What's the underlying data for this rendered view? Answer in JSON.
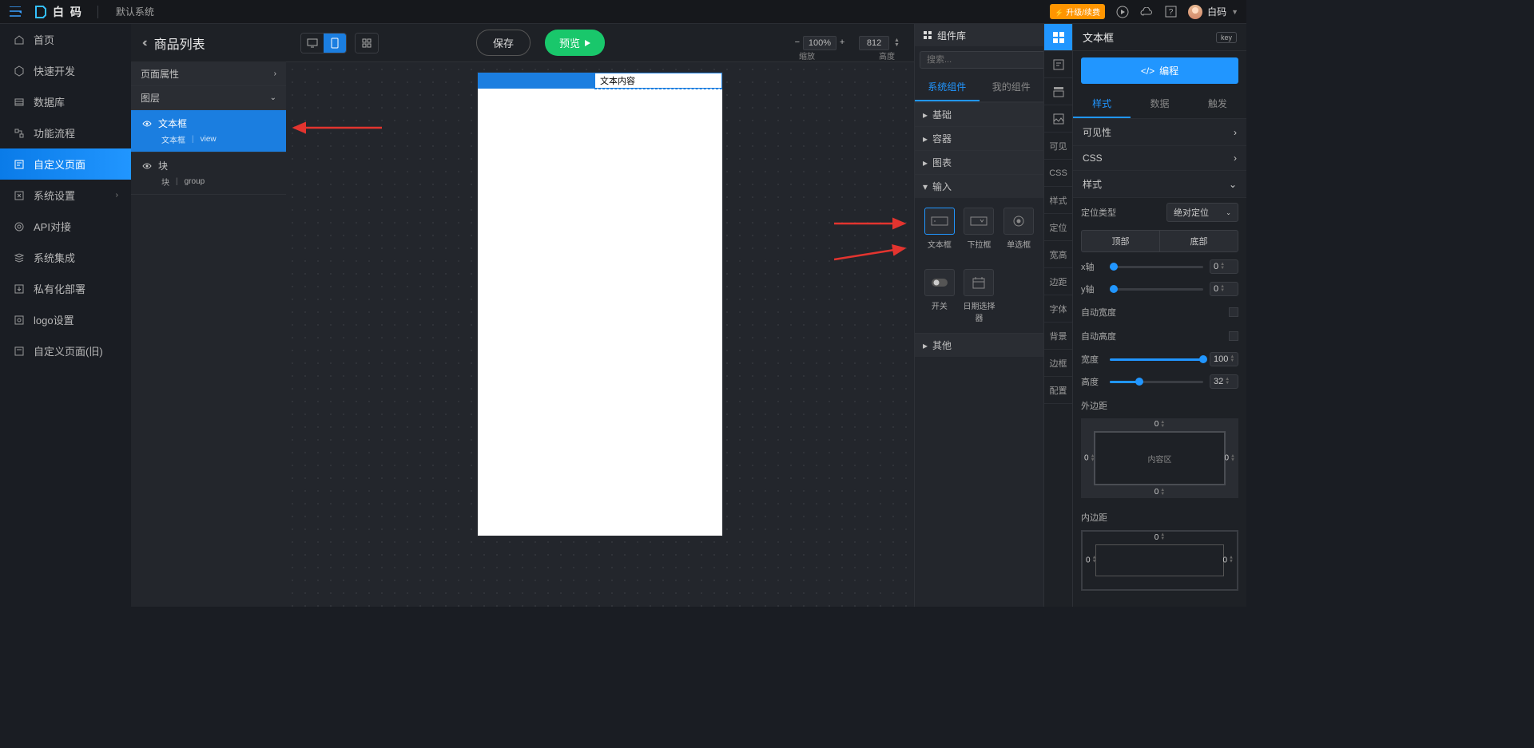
{
  "header": {
    "brand": "白 码",
    "system": "默认系统",
    "upgrade": "升级/续费",
    "user": "白码"
  },
  "sidebar": {
    "items": [
      "首页",
      "快速开发",
      "数据库",
      "功能流程",
      "自定义页面",
      "系统设置",
      "API对接",
      "系统集成",
      "私有化部署",
      "logo设置",
      "自定义页面(旧)"
    ],
    "active": 4
  },
  "page": {
    "title": "商品列表"
  },
  "layers_panel": {
    "page_attr": "页面属性",
    "layers": "图层",
    "items": [
      {
        "name": "文本框",
        "sub1": "文本框",
        "sub2": "view",
        "selected": true
      },
      {
        "name": "块",
        "sub1": "块",
        "sub2": "group",
        "selected": false
      }
    ]
  },
  "center_toolbar": {
    "save": "保存",
    "preview": "预览",
    "zoom": "100%",
    "zoom_label": "缩放",
    "height": "812",
    "height_label": "高度"
  },
  "canvas": {
    "input_value": "文本内容"
  },
  "comp": {
    "title": "组件库",
    "search_ph": "搜索...",
    "tabs": [
      "系统组件",
      "我的组件"
    ],
    "acc": [
      "基础",
      "容器",
      "图表",
      "输入",
      "其他"
    ],
    "input_items": [
      "文本框",
      "下拉框",
      "单选框",
      "开关",
      "日期选择器"
    ]
  },
  "mini_tabs": [
    "可见",
    "CSS",
    "样式",
    "定位",
    "宽高",
    "边距",
    "字体",
    "背景",
    "边框",
    "配置"
  ],
  "props": {
    "title": "文本框",
    "key": "key",
    "code": "编程",
    "tabs": [
      "样式",
      "数据",
      "触发"
    ],
    "visibility": "可见性",
    "css": "CSS",
    "style": "样式",
    "position_type": "定位类型",
    "position_val": "绝对定位",
    "top": "顶部",
    "bottom": "底部",
    "x": "x轴",
    "y": "y轴",
    "auto_w": "自动宽度",
    "auto_h": "自动高度",
    "width": "宽度",
    "height": "高度",
    "margin_lbl": "外边距",
    "content": "内容区",
    "padding_lbl": "内边距",
    "vals": {
      "x": "0",
      "y": "0",
      "w": "100",
      "h": "32",
      "m": "0"
    }
  }
}
